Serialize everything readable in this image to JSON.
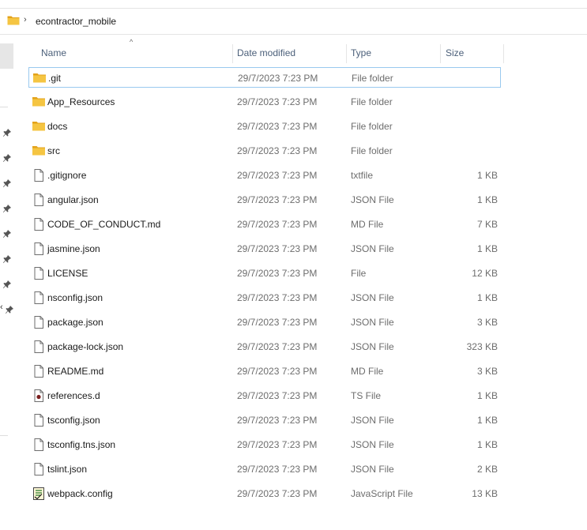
{
  "address": {
    "separator": "›",
    "crumb": "econtractor_mobile"
  },
  "columns": {
    "name": "Name",
    "date": "Date modified",
    "type": "Type",
    "size": "Size",
    "sort_indicator": "^"
  },
  "nav": {
    "cut_text": "‹"
  },
  "files": [
    {
      "name": ".git",
      "date": "29/7/2023 7:23 PM",
      "type": "File folder",
      "size": "",
      "icon": "folder-icon"
    },
    {
      "name": "App_Resources",
      "date": "29/7/2023 7:23 PM",
      "type": "File folder",
      "size": "",
      "icon": "folder-icon"
    },
    {
      "name": "docs",
      "date": "29/7/2023 7:23 PM",
      "type": "File folder",
      "size": "",
      "icon": "folder-icon"
    },
    {
      "name": "src",
      "date": "29/7/2023 7:23 PM",
      "type": "File folder",
      "size": "",
      "icon": "folder-icon"
    },
    {
      "name": ".gitignore",
      "date": "29/7/2023 7:23 PM",
      "type": "txtfile",
      "size": "1 KB",
      "icon": "file-icon"
    },
    {
      "name": "angular.json",
      "date": "29/7/2023 7:23 PM",
      "type": "JSON File",
      "size": "1 KB",
      "icon": "file-icon"
    },
    {
      "name": "CODE_OF_CONDUCT.md",
      "date": "29/7/2023 7:23 PM",
      "type": "MD File",
      "size": "7 KB",
      "icon": "file-icon"
    },
    {
      "name": "jasmine.json",
      "date": "29/7/2023 7:23 PM",
      "type": "JSON File",
      "size": "1 KB",
      "icon": "file-icon"
    },
    {
      "name": "LICENSE",
      "date": "29/7/2023 7:23 PM",
      "type": "File",
      "size": "12 KB",
      "icon": "file-icon"
    },
    {
      "name": "nsconfig.json",
      "date": "29/7/2023 7:23 PM",
      "type": "JSON File",
      "size": "1 KB",
      "icon": "file-icon"
    },
    {
      "name": "package.json",
      "date": "29/7/2023 7:23 PM",
      "type": "JSON File",
      "size": "3 KB",
      "icon": "file-icon"
    },
    {
      "name": "package-lock.json",
      "date": "29/7/2023 7:23 PM",
      "type": "JSON File",
      "size": "323 KB",
      "icon": "file-icon"
    },
    {
      "name": "README.md",
      "date": "29/7/2023 7:23 PM",
      "type": "MD File",
      "size": "3 KB",
      "icon": "file-icon"
    },
    {
      "name": "references.d",
      "date": "29/7/2023 7:23 PM",
      "type": "TS File",
      "size": "1 KB",
      "icon": "ts-file-icon"
    },
    {
      "name": "tsconfig.json",
      "date": "29/7/2023 7:23 PM",
      "type": "JSON File",
      "size": "1 KB",
      "icon": "file-icon"
    },
    {
      "name": "tsconfig.tns.json",
      "date": "29/7/2023 7:23 PM",
      "type": "JSON File",
      "size": "1 KB",
      "icon": "file-icon"
    },
    {
      "name": "tslint.json",
      "date": "29/7/2023 7:23 PM",
      "type": "JSON File",
      "size": "2 KB",
      "icon": "file-icon"
    },
    {
      "name": "webpack.config",
      "date": "29/7/2023 7:23 PM",
      "type": "JavaScript File",
      "size": "13 KB",
      "icon": "js-file-icon"
    }
  ],
  "selected_row": 0,
  "colors": {
    "folder": "#f5c542",
    "folder_dark": "#e3a21a",
    "selection_border": "#99c9ef",
    "header_text": "#4c607a"
  }
}
